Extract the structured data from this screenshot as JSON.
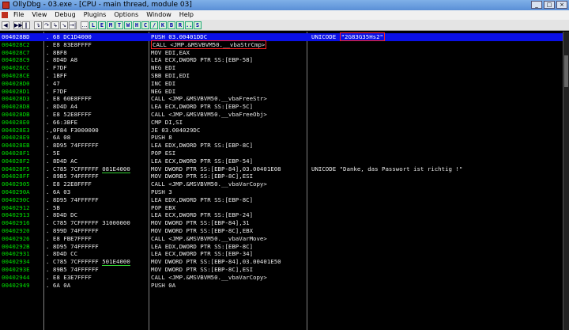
{
  "titlebar": {
    "title": "OllyDbg - 03.exe - [CPU - main thread, module 03]",
    "min": "_",
    "max": "□",
    "close": "×"
  },
  "menu": [
    "File",
    "View",
    "Debug",
    "Plugins",
    "Options",
    "Window",
    "Help"
  ],
  "toolbar": {
    "buttons": [
      "◀",
      "▶▶",
      "‖",
      "↴",
      "↷",
      "↳",
      "↘",
      "→|",
      "…"
    ],
    "letters": [
      "L",
      "E",
      "M",
      "T",
      "W",
      "H",
      "C",
      "/",
      "K",
      "B",
      "R",
      "...",
      "S"
    ]
  },
  "rows": [
    {
      "addr": "004028BD",
      "hex": ". 68 DC1D4000",
      "dis": "PUSH 03.00401DDC",
      "cmt": "UNICODE ",
      "cmt_box": "\"2G83G35Hs2\"",
      "sel": true
    },
    {
      "addr": "004028C2",
      "hex": ". E8 83E8FFFF",
      "dis_box": "CALL <JMP.&MSVBVM50.__vbaStrCmp>"
    },
    {
      "addr": "004028C7",
      "hex": ". 8BF8",
      "dis": "MOV EDI,EAX"
    },
    {
      "addr": "004028C9",
      "hex": ". 8D4D A8",
      "dis": "LEA ECX,DWORD PTR SS:[EBP-58]"
    },
    {
      "addr": "004028CC",
      "hex": ". F7DF",
      "dis": "NEG EDI"
    },
    {
      "addr": "004028CE",
      "hex": ". 1BFF",
      "dis": "SBB EDI,EDI"
    },
    {
      "addr": "004028D0",
      "hex": ". 47",
      "dis": "INC EDI"
    },
    {
      "addr": "004028D1",
      "hex": ". F7DF",
      "dis": "NEG EDI"
    },
    {
      "addr": "004028D3",
      "hex": ". E8 60E8FFFF",
      "dis": "CALL <JMP.&MSVBVM50.__vbaFreeStr>"
    },
    {
      "addr": "004028D8",
      "hex": ". 8D4D A4",
      "dis": "LEA ECX,DWORD PTR SS:[EBP-5C]"
    },
    {
      "addr": "004028DB",
      "hex": ". E8 52E8FFFF",
      "dis": "CALL <JMP.&MSVBVM50.__vbaFreeObj>"
    },
    {
      "addr": "004028E0",
      "hex": ". 66:3BFE",
      "dis": "CMP DI,SI"
    },
    {
      "addr": "004028E3",
      "hex": ".,0F84 F3000000",
      "dis": "JE 03.004029DC"
    },
    {
      "addr": "004028E9",
      "hex": ". 6A 08",
      "dis": "PUSH 8"
    },
    {
      "addr": "004028EB",
      "hex": ". 8D95 74FFFFFF",
      "dis": "LEA EDX,DWORD PTR SS:[EBP-8C]"
    },
    {
      "addr": "004028F1",
      "hex": ". 5E",
      "dis": "POP ESI"
    },
    {
      "addr": "004028F2",
      "hex": ". 8D4D AC",
      "dis": "LEA ECX,DWORD PTR SS:[EBP-54]"
    },
    {
      "addr": "004028F5",
      "hex": ". C785 7CFFFFFF ",
      "hex_ul": "081E4000",
      "dis": "MOV DWORD PTR SS:[EBP-84],03.00401E08",
      "cmt": "UNICODE \"Danke, das Passwort ist richtig !\""
    },
    {
      "addr": "004028FF",
      "hex": ". 89B5 74FFFFFF",
      "dis": "MOV DWORD PTR SS:[EBP-8C],ESI"
    },
    {
      "addr": "00402905",
      "hex": ". E8 22E8FFFF",
      "dis": "CALL <JMP.&MSVBVM50.__vbaVarCopy>"
    },
    {
      "addr": "0040290A",
      "hex": ". 6A 03",
      "dis": "PUSH 3"
    },
    {
      "addr": "0040290C",
      "hex": ". 8D95 74FFFFFF",
      "dis": "LEA EDX,DWORD PTR SS:[EBP-8C]"
    },
    {
      "addr": "00402912",
      "hex": ". 5B",
      "dis": "POP EBX"
    },
    {
      "addr": "00402913",
      "hex": ". 8D4D DC",
      "dis": "LEA ECX,DWORD PTR SS:[EBP-24]"
    },
    {
      "addr": "00402916",
      "hex": ". C785 7CFFFFFF 31000000",
      "dis": "MOV DWORD PTR SS:[EBP-84],31"
    },
    {
      "addr": "00402920",
      "hex": ". 899D 74FFFFFF",
      "dis": "MOV DWORD PTR SS:[EBP-8C],EBX"
    },
    {
      "addr": "00402926",
      "hex": ". E8 FBE7FFFF",
      "dis": "CALL <JMP.&MSVBVM50.__vbaVarMove>"
    },
    {
      "addr": "0040292B",
      "hex": ". 8D95 74FFFFFF",
      "dis": "LEA EDX,DWORD PTR SS:[EBP-8C]"
    },
    {
      "addr": "00402931",
      "hex": ". 8D4D CC",
      "dis": "LEA ECX,DWORD PTR SS:[EBP-34]"
    },
    {
      "addr": "00402934",
      "hex": ". C785 7CFFFFFF ",
      "hex_ul": "501E4000",
      "dis": "MOV DWORD PTR SS:[EBP-84],03.00401E50"
    },
    {
      "addr": "0040293E",
      "hex": ". 89B5 74FFFFFF",
      "dis": "MOV DWORD PTR SS:[EBP-8C],ESI"
    },
    {
      "addr": "00402944",
      "hex": ". E8 E3E7FFFF",
      "dis": "CALL <JMP.&MSVBVM50.__vbaVarCopy>"
    },
    {
      "addr": "00402949",
      "hex": ". 6A 0A",
      "dis": "PUSH 0A"
    }
  ]
}
